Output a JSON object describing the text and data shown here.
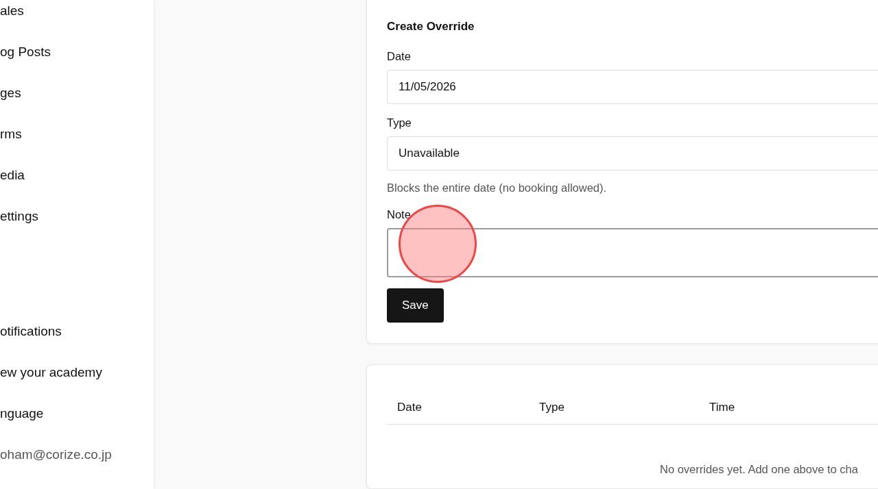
{
  "sidebar": {
    "items": [
      {
        "label": "ales"
      },
      {
        "label": "og Posts"
      },
      {
        "label": "ges"
      },
      {
        "label": "rms"
      },
      {
        "label": "edia"
      },
      {
        "label": "ettings"
      }
    ],
    "bottom_items": [
      {
        "label": "otifications"
      },
      {
        "label": "ew your academy"
      },
      {
        "label": "nguage"
      }
    ],
    "user_email": "oham@corize.co.jp"
  },
  "form": {
    "title": "Create Override",
    "date": {
      "label": "Date",
      "value": "11/05/2026"
    },
    "type": {
      "label": "Type",
      "value": "Unavailable",
      "help": "Blocks the entire date (no booking allowed)."
    },
    "note": {
      "label": "Note",
      "focused": true
    },
    "save_button": "Save"
  },
  "table": {
    "columns": [
      "Date",
      "Type",
      "Time"
    ],
    "empty_message": "No overrides yet. Add one above to cha"
  }
}
